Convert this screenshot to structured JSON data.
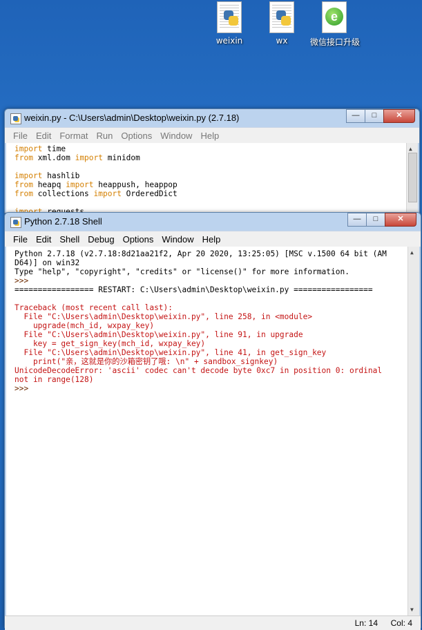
{
  "desktop": {
    "icons": [
      {
        "label": "weixin",
        "icon": "python-file-icon"
      },
      {
        "label": "wx",
        "icon": "python-file-icon"
      },
      {
        "label": "微信接口升级",
        "icon": "exe-file-icon"
      }
    ]
  },
  "editor": {
    "title": "weixin.py - C:\\Users\\admin\\Desktop\\weixin.py (2.7.18)",
    "menu": [
      "File",
      "Edit",
      "Format",
      "Run",
      "Options",
      "Window",
      "Help"
    ],
    "lines": [
      [
        {
          "t": "import",
          "c": "kw"
        },
        {
          "t": " time",
          "c": "txt"
        }
      ],
      [
        {
          "t": "from",
          "c": "kw"
        },
        {
          "t": " xml.dom ",
          "c": "txt"
        },
        {
          "t": "import",
          "c": "kw"
        },
        {
          "t": " minidom",
          "c": "txt"
        }
      ],
      [],
      [
        {
          "t": "import",
          "c": "kw"
        },
        {
          "t": " hashlib",
          "c": "txt"
        }
      ],
      [
        {
          "t": "from",
          "c": "kw"
        },
        {
          "t": " heapq ",
          "c": "txt"
        },
        {
          "t": "import",
          "c": "kw"
        },
        {
          "t": " heappush, heappop",
          "c": "txt"
        }
      ],
      [
        {
          "t": "from",
          "c": "kw"
        },
        {
          "t": " collections ",
          "c": "txt"
        },
        {
          "t": "import",
          "c": "kw"
        },
        {
          "t": " OrderedDict",
          "c": "txt"
        }
      ],
      [],
      [
        {
          "t": "import",
          "c": "kw"
        },
        {
          "t": " requests",
          "c": "txt"
        }
      ]
    ]
  },
  "shell": {
    "title": "Python 2.7.18 Shell",
    "menu": [
      "File",
      "Edit",
      "Shell",
      "Debug",
      "Options",
      "Window",
      "Help"
    ],
    "lines": [
      [
        {
          "t": "Python 2.7.18 (v2.7.18:8d21aa21f2, Apr 20 2020, 13:25:05) [MSC v.1500 64 bit (AM",
          "c": "txt"
        }
      ],
      [
        {
          "t": "D64)] on win32",
          "c": "txt"
        }
      ],
      [
        {
          "t": "Type \"help\", \"copyright\", \"credits\" or \"license()\" for more information.",
          "c": "txt"
        }
      ],
      [
        {
          "t": ">>> ",
          "c": "prompt"
        }
      ],
      [
        {
          "t": "================= RESTART: C:\\Users\\admin\\Desktop\\weixin.py =================",
          "c": "txt"
        }
      ],
      [],
      [
        {
          "t": "Traceback (most recent call last):",
          "c": "red"
        }
      ],
      [
        {
          "t": "  File \"C:\\Users\\admin\\Desktop\\weixin.py\", line 258, in <module>",
          "c": "red"
        }
      ],
      [
        {
          "t": "    upgrade(mch_id, wxpay_key)",
          "c": "red"
        }
      ],
      [
        {
          "t": "  File \"C:\\Users\\admin\\Desktop\\weixin.py\", line 91, in upgrade",
          "c": "red"
        }
      ],
      [
        {
          "t": "    key = get_sign_key(mch_id, wxpay_key)",
          "c": "red"
        }
      ],
      [
        {
          "t": "  File \"C:\\Users\\admin\\Desktop\\weixin.py\", line 41, in get_sign_key",
          "c": "red"
        }
      ],
      [
        {
          "t": "    print(\"亲，这就是你的沙箱密钥了哦: \\n\" + sandbox_signkey)",
          "c": "red"
        }
      ],
      [
        {
          "t": "UnicodeDecodeError: 'ascii' codec can't decode byte 0xc7 in position 0: ordinal",
          "c": "red"
        }
      ],
      [
        {
          "t": "not in range(128)",
          "c": "red"
        }
      ],
      [
        {
          "t": ">>> ",
          "c": "prompt"
        }
      ]
    ],
    "status": {
      "ln": "Ln: 14",
      "col": "Col: 4"
    }
  }
}
